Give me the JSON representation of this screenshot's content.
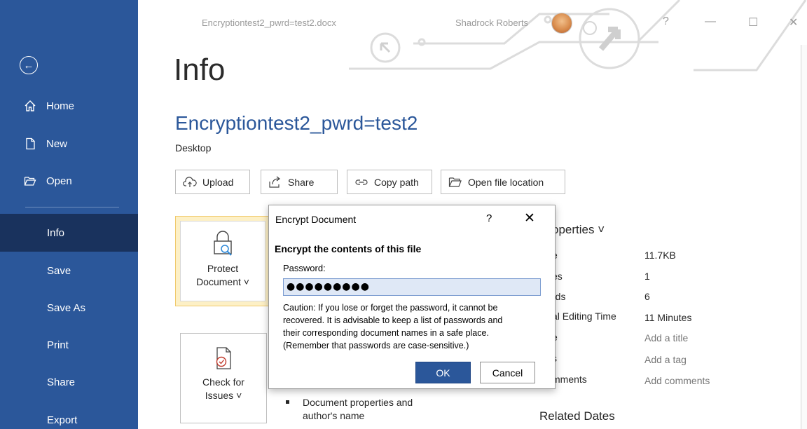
{
  "window": {
    "doc_filename": "Encryptiontest2_pwrd=test2.docx",
    "user_name": "Shadrock Roberts",
    "help_glyph": "?",
    "minimize_glyph": "—",
    "restore_glyph": "☐",
    "close_glyph": "✕"
  },
  "sidebar": {
    "back_icon": "back-arrow-icon",
    "items": [
      {
        "label": "Home",
        "icon": "home-icon"
      },
      {
        "label": "New",
        "icon": "new-document-icon"
      },
      {
        "label": "Open",
        "icon": "open-folder-icon"
      },
      {
        "label": "Info"
      },
      {
        "label": "Save"
      },
      {
        "label": "Save As"
      },
      {
        "label": "Print"
      },
      {
        "label": "Share"
      },
      {
        "label": "Export"
      }
    ],
    "active": "Info",
    "accent": "#2b579a",
    "active_bg": "#19325d"
  },
  "main": {
    "page_title": "Info",
    "doc_title": "Encryptiontest2_pwrd=test2",
    "location": "Desktop",
    "actions": [
      {
        "label": "Upload",
        "icon": "upload-cloud-icon"
      },
      {
        "label": "Share",
        "icon": "share-arrow-icon"
      },
      {
        "label": "Copy path",
        "icon": "link-icon"
      },
      {
        "label": "Open file location",
        "icon": "folder-icon"
      }
    ],
    "protect_tile": {
      "line1": "Protect",
      "line2": "Document ˅",
      "icon": "lock-icon"
    },
    "check_tile": {
      "line1": "Check for",
      "line2": "Issues ˅",
      "icon": "check-document-icon"
    },
    "bullet_text_line1": "Document properties and",
    "bullet_text_line2": "author's name"
  },
  "properties": {
    "title": "operties ˅",
    "rows": [
      {
        "label": "e",
        "value": "11.7KB"
      },
      {
        "label": "es",
        "value": "1"
      },
      {
        "label": "rds",
        "value": "6"
      },
      {
        "label": "al Editing Time",
        "value": "11 Minutes"
      },
      {
        "label": "e",
        "value": "Add a title"
      },
      {
        "label": "s",
        "value": "Add a tag"
      },
      {
        "label": "mments",
        "value": "Add comments"
      }
    ],
    "related_dates": "Related Dates"
  },
  "dialog": {
    "title": "Encrypt Document",
    "help": "?",
    "close": "✕",
    "heading": "Encrypt the contents of this file",
    "password_label": "Password:",
    "password_value": "●●●●●●●●●",
    "caution_line1": "Caution: If you lose or forget the password, it cannot be",
    "caution_line2": "recovered. It is advisable to keep a list of passwords and",
    "caution_line3": "their corresponding document names in a safe place.",
    "caution_line4": "(Remember that passwords are case-sensitive.)",
    "ok_label": "OK",
    "cancel_label": "Cancel"
  }
}
